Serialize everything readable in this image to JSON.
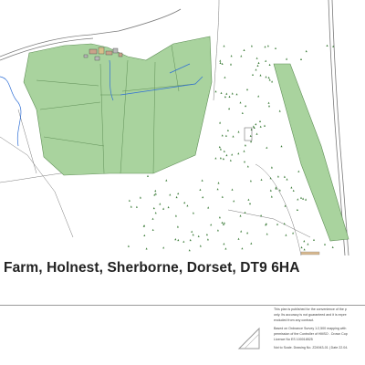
{
  "title": "Farm, Holnest, Sherborne, Dorset, DT9 6HA",
  "colors": {
    "field_fill": "#a9d39e",
    "field_stroke": "#5f8f56",
    "woodland_symbol": "#3d7d3a",
    "water": "#2f6fd6",
    "road": "#7a7a7a",
    "paper": "#ffffff"
  },
  "icons": {
    "logo": "agent-logo-icon"
  },
  "notes": [
    "This plan is published for the convenience of the p",
    "only. Its accuracy is not guaranteed and it is expre",
    "excluded from any contract.",
    "Based on Ordnance Survey 1:2,500 mapping with",
    "permission of the Controller of HMSO . Crown Cop",
    "Licence No ES 100018525",
    "Not to Scale. Drawing No. Z24943-01 | Date 22.04."
  ]
}
